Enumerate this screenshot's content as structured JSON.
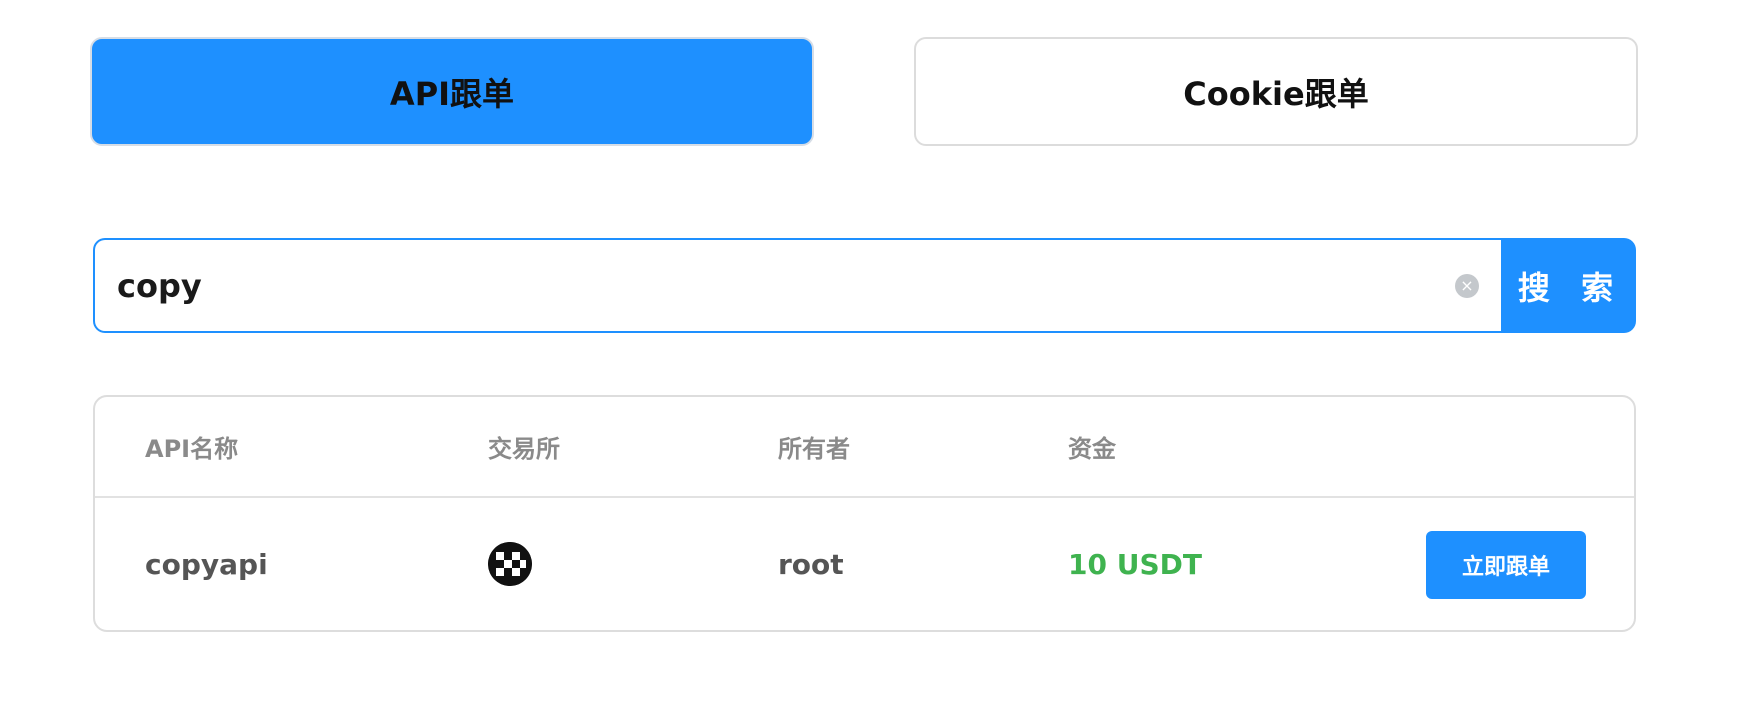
{
  "tabs": {
    "api_label": "API跟单",
    "cookie_label": "Cookie跟单"
  },
  "search": {
    "value": "copy",
    "button_label": "搜 索",
    "clear_icon": "close-circle-icon"
  },
  "table": {
    "headers": [
      "API名称",
      "交易所",
      "所有者",
      "资金"
    ],
    "rows": [
      {
        "api_name": "copyapi",
        "exchange_icon": "okx-logo-icon",
        "owner": "root",
        "funds": "10 USDT",
        "action_label": "立即跟单"
      }
    ]
  },
  "colors": {
    "accent": "#1e90ff",
    "funds_green": "#3fb34f",
    "header_text": "#8a8a8a",
    "border": "#dddddd"
  }
}
